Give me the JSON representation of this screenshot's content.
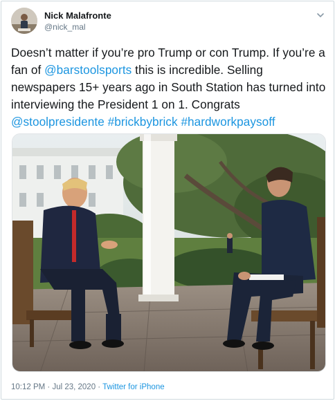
{
  "author": {
    "display_name": "Nick Malafronte",
    "handle": "@nick_mal",
    "avatar_icon": "avatar-photo"
  },
  "menu": {
    "icon": "chevron-down-icon"
  },
  "tweet": {
    "t1": "Doesn’t matter if you’re pro Trump or con Trump. If you’re a fan of ",
    "m1": "@barstoolsports",
    "t2": " this is incredible. Selling newspapers 15+ years ago in South Station has turned into interviewing the President 1 on 1. Congrats ",
    "m2": "@stoolpresidente",
    "h1": "#brickbybrick",
    "h2": "#hardworkpaysoff"
  },
  "media": {
    "description_icon": "photo-interview"
  },
  "footer": {
    "timestamp": "10:12 PM · Jul 23, 2020 · ",
    "source": "Twitter for iPhone"
  },
  "colors": {
    "link": "#1b95e0",
    "text": "#14171a",
    "secondary": "#657786"
  }
}
